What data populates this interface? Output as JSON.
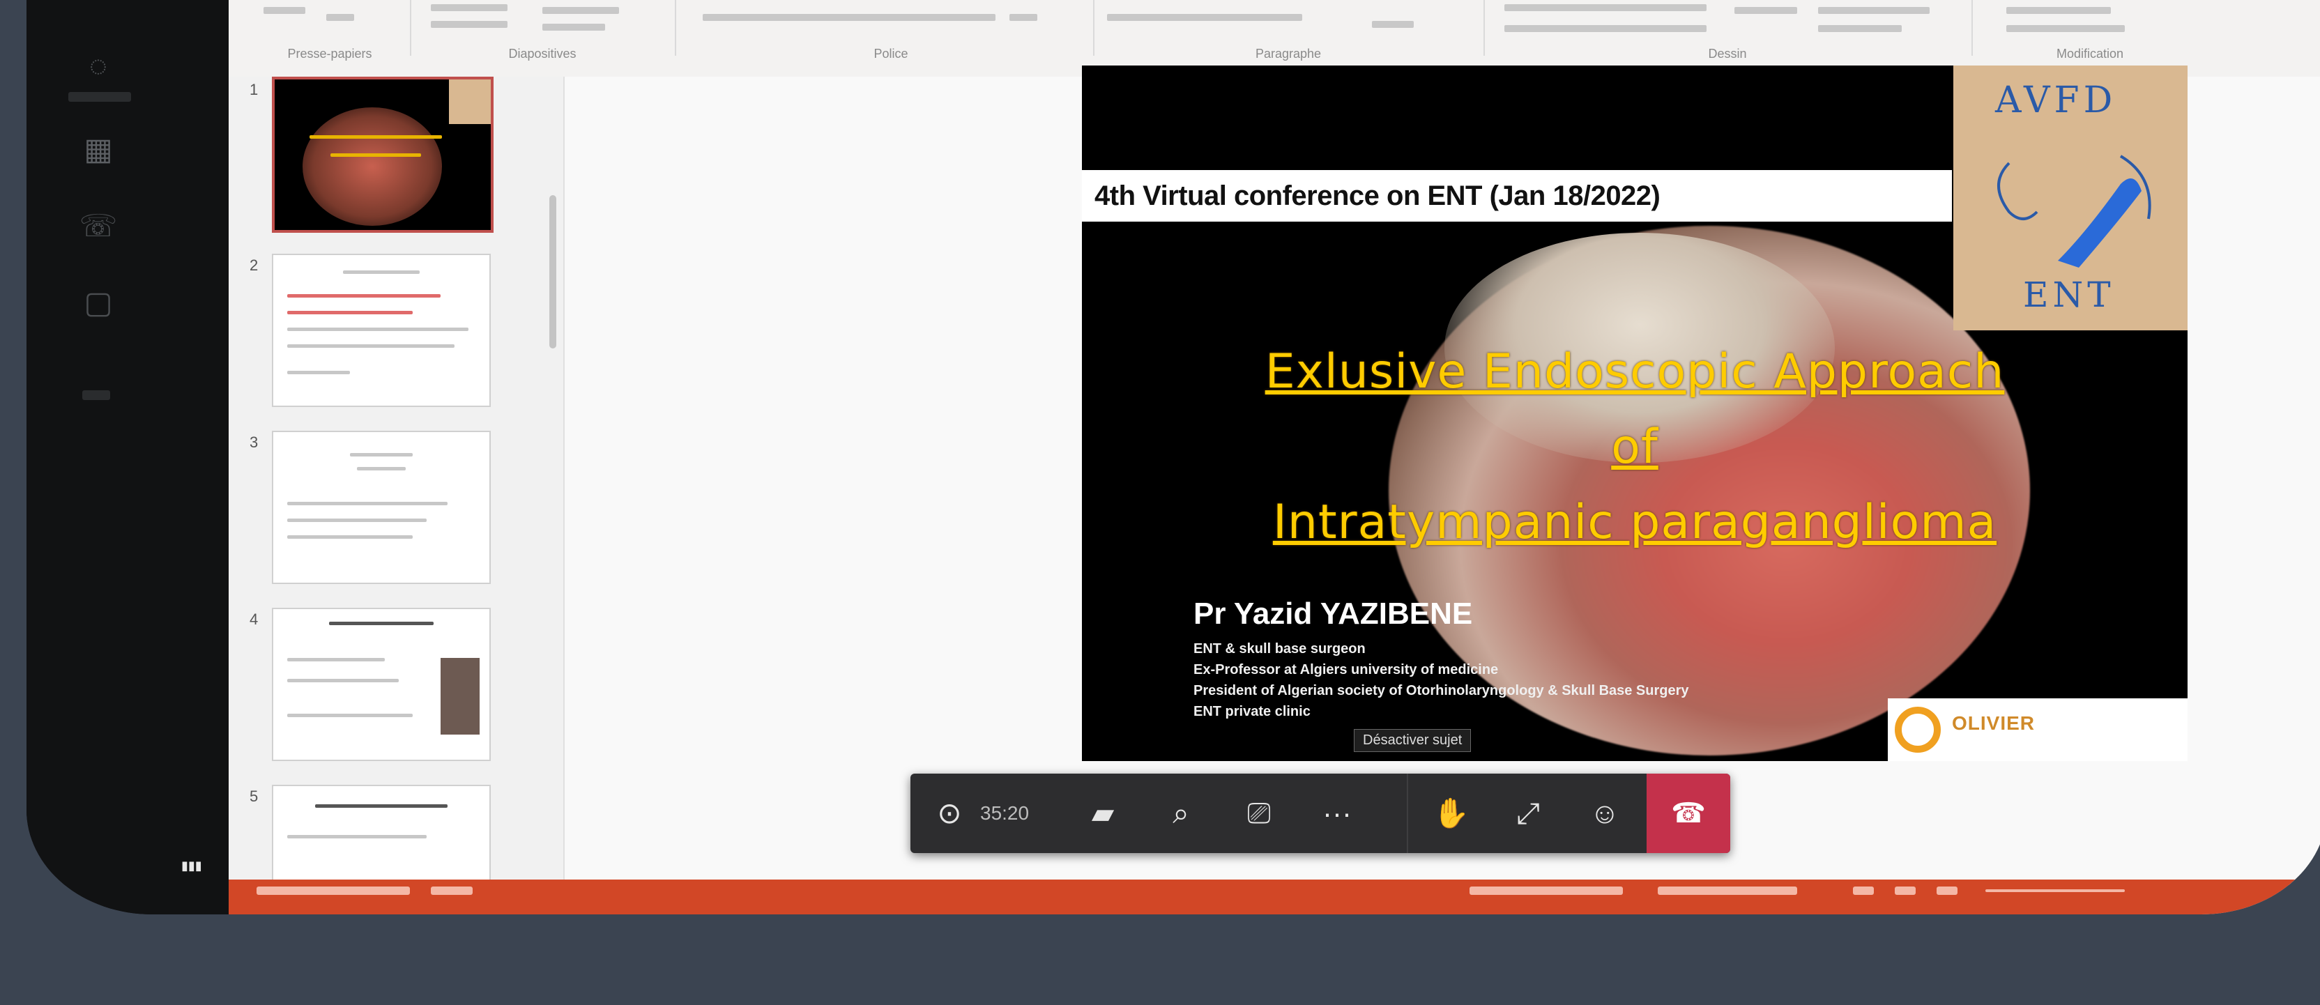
{
  "ribbon": {
    "groups": [
      "Presse-papiers",
      "Diapositives",
      "Police",
      "Paragraphe",
      "Dessin",
      "Modification"
    ]
  },
  "thumbnails": [
    {
      "number": "1"
    },
    {
      "number": "2"
    },
    {
      "number": "3"
    },
    {
      "number": "4"
    },
    {
      "number": "5"
    }
  ],
  "slide": {
    "conference": "4th Virtual conference on ENT (Jan 18/2022)",
    "title_lines": [
      "Exlusive Endoscopic Approach",
      "of",
      "Intratympanic paraganglioma"
    ],
    "author": "Pr Yazid YAZIBENE",
    "affiliations": [
      "ENT & skull base surgeon",
      "Ex-Professor at Algiers university of medicine",
      "President of Algerian society of Otorhinolaryngology & Skull Base Surgery",
      "ENT private clinic"
    ],
    "logo_top": "AVFD",
    "logo_bottom": "ENT",
    "footer_logo": "OLIVIER"
  },
  "tooltip": "Désactiver sujet",
  "call": {
    "time": "35:20",
    "controls": [
      "timer-icon",
      "video-off-icon",
      "search-icon",
      "share-screen-icon",
      "more-icon",
      "hand-icon",
      "expand-icon",
      "participants-icon"
    ],
    "end_label": "leave-call-icon"
  },
  "colors": {
    "title": "#ffcc00",
    "status_bar": "#d24726",
    "end_call": "#c4314b",
    "background": "#3b4451"
  }
}
